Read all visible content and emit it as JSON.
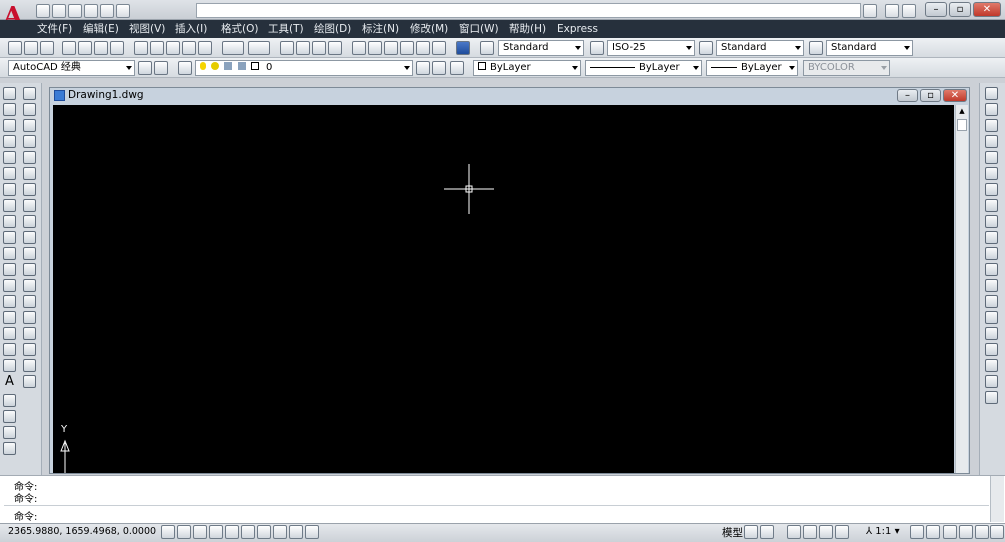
{
  "menubar": {
    "items": [
      "文件(F)",
      "编辑(E)",
      "视图(V)",
      "插入(I)",
      "格式(O)",
      "工具(T)",
      "绘图(D)",
      "标注(N)",
      "修改(M)",
      "窗口(W)",
      "帮助(H)",
      "Express"
    ]
  },
  "toolbar_styles": {
    "text_style": "Standard",
    "dim_style": "ISO-25",
    "table_style": "Standard",
    "multileader_style": "Standard"
  },
  "toolbar_layers": {
    "workspace": "AutoCAD 经典",
    "layer": "0",
    "color": "ByLayer",
    "linetype": "ByLayer",
    "lineweight": "ByLayer",
    "plotstyle": "BYCOLOR"
  },
  "document": {
    "title": "Drawing1.dwg",
    "ucs_y_label": "Y"
  },
  "command": {
    "line1": "命令:",
    "line2": "命令:",
    "prompt": "命令:"
  },
  "status": {
    "coords": "2365.9880, 1659.4968, 0.0000",
    "model_label": "模型",
    "annotation_scale": "1:1"
  },
  "colors": {
    "canvas": "#000000",
    "menubar": "#26303c",
    "logo": "#c8102e"
  }
}
